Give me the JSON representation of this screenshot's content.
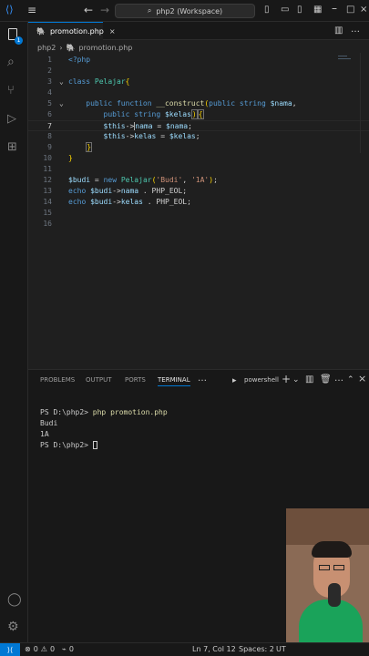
{
  "titlebar": {
    "search_text": "php2 (Workspace)"
  },
  "tab": {
    "label": "promotion.php"
  },
  "breadcrumb": {
    "folder": "php2",
    "file": "promotion.php"
  },
  "activity": {
    "badge": "1"
  },
  "editor": {
    "line_numbers": [
      "1",
      "2",
      "3",
      "4",
      "5",
      "6",
      "7",
      "8",
      "9",
      "10",
      "11",
      "12",
      "13",
      "14",
      "15",
      "16"
    ],
    "cursor_line": "7"
  },
  "panel": {
    "tabs": [
      "PROBLEMS",
      "OUTPUT",
      "PORTS",
      "TERMINAL"
    ],
    "shell": "powershell",
    "terminal_lines": [
      "PS D:\\php2> php promotion.php",
      "Budi",
      "1A",
      "PS D:\\php2> "
    ],
    "command": "php promotion.php"
  },
  "status": {
    "errors": "0",
    "warnings": "0",
    "ports": "0",
    "position": "Ln 7, Col 12",
    "spaces": "Spaces: 2",
    "encoding": "UT"
  },
  "colors": {
    "accent": "#0078d4",
    "background": "#1f1f1f",
    "sidebar": "#181818"
  }
}
